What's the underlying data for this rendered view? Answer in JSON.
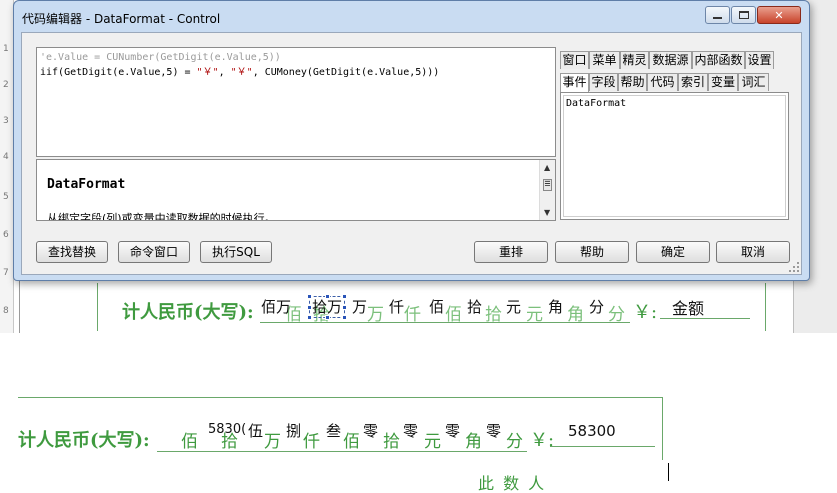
{
  "dialog": {
    "title": "代码编辑器 - DataFormat - Control",
    "controls": {
      "minimize": "0",
      "maximize": "1",
      "close": "r"
    }
  },
  "editor": {
    "line1": "'e.Value = CUNumber(GetDigit(e.Value,5))",
    "line2_a": "iif(GetDigit(e.Value,5) = ",
    "line2_s1": "\"￥\"",
    "line2_b": ", ",
    "line2_s2": "\"￥\"",
    "line2_c": ", CUMoney(GetDigit(e.Value,5)))"
  },
  "help": {
    "title": "DataFormat",
    "description": "从绑定字段(列)或变量中读取数据的时候执行。",
    "scroll_up": "▲",
    "scroll_mid": "☰",
    "scroll_down": "▼"
  },
  "tabs_row1": [
    "窗口",
    "菜单",
    "精灵",
    "数据源",
    "内部函数",
    "设置"
  ],
  "tabs_row2": [
    "事件",
    "字段",
    "帮助",
    "代码",
    "索引",
    "变量",
    "词汇"
  ],
  "event_list": [
    "DataFormat"
  ],
  "buttons": {
    "find_replace": "查找替换",
    "command_window": "命令窗口",
    "execute_sql": "执行SQL",
    "rearrange": "重排",
    "help": "帮助",
    "ok": "确定",
    "cancel": "取消"
  },
  "ruler": [
    "1",
    "2",
    "3",
    "4",
    "5",
    "6",
    "7",
    "8"
  ],
  "doc_top": {
    "label": "计人民币(大写):",
    "units": [
      "佰",
      "拾",
      "万",
      "仟",
      "佰",
      "拾",
      "元",
      "角",
      "分"
    ],
    "values": [
      "佰万",
      "拾万",
      "万",
      "仟",
      "佰",
      "拾",
      "元",
      "角",
      "分"
    ],
    "yen": "￥:",
    "amount": "金额"
  },
  "doc_bottom": {
    "label": "计人民币(大写):",
    "units": [
      "佰",
      "拾",
      "万",
      "仟",
      "佰",
      "拾",
      "元",
      "角",
      "分"
    ],
    "values": [
      "5830(",
      "伍",
      "捌",
      "叁",
      "零",
      "零",
      "零",
      "零"
    ],
    "yen": "￥:",
    "amount": "58300",
    "footer_fragment": "此 数 人"
  },
  "colors": {
    "form_green": "#3f9a3f",
    "dialog_frame": "#c9dcf2",
    "selection": "#2a54b8"
  }
}
